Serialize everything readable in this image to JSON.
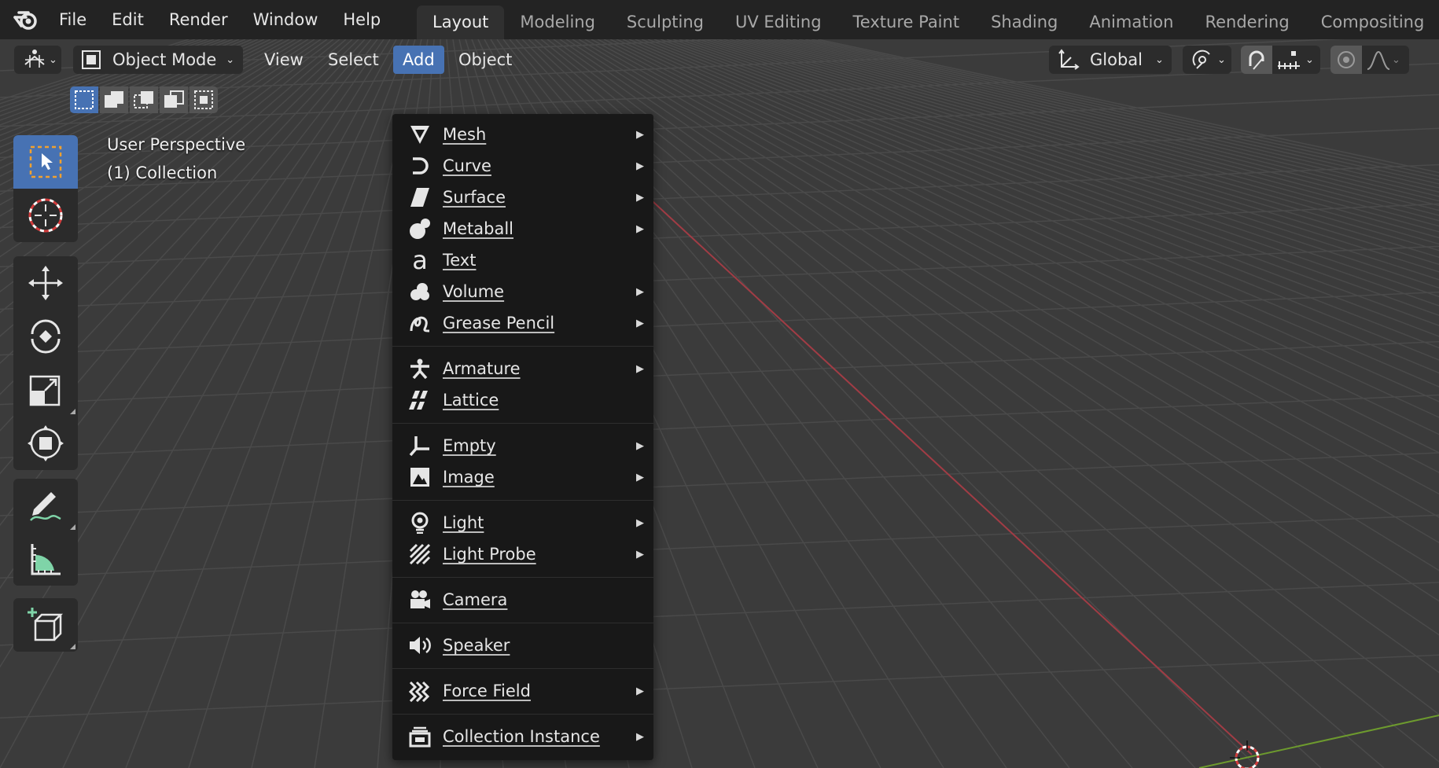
{
  "topbar": {
    "menus": [
      "File",
      "Edit",
      "Render",
      "Window",
      "Help"
    ],
    "workspaces": [
      "Layout",
      "Modeling",
      "Sculpting",
      "UV Editing",
      "Texture Paint",
      "Shading",
      "Animation",
      "Rendering",
      "Compositing"
    ],
    "active_workspace": "Layout"
  },
  "header": {
    "mode": "Object Mode",
    "menus": [
      "View",
      "Select",
      "Add",
      "Object"
    ],
    "active_menu": "Add",
    "transform_orientation": "Global"
  },
  "overlay": {
    "view_name": "User Perspective",
    "collection": "(1) Collection"
  },
  "add_menu": {
    "items": [
      {
        "label": "Mesh",
        "icon": "mesh-icon",
        "submenu": true
      },
      {
        "label": "Curve",
        "icon": "curve-icon",
        "submenu": true
      },
      {
        "label": "Surface",
        "icon": "surface-icon",
        "submenu": true
      },
      {
        "label": "Metaball",
        "icon": "metaball-icon",
        "submenu": true
      },
      {
        "label": "Text",
        "icon": "text-icon",
        "submenu": false
      },
      {
        "label": "Volume",
        "icon": "volume-icon",
        "submenu": true
      },
      {
        "label": "Grease Pencil",
        "icon": "grease-pencil-icon",
        "submenu": true
      },
      {
        "label": "Armature",
        "icon": "armature-icon",
        "submenu": true
      },
      {
        "label": "Lattice",
        "icon": "lattice-icon",
        "submenu": false
      },
      {
        "label": "Empty",
        "icon": "empty-icon",
        "submenu": true
      },
      {
        "label": "Image",
        "icon": "image-icon",
        "submenu": true
      },
      {
        "label": "Light",
        "icon": "light-icon",
        "submenu": true
      },
      {
        "label": "Light Probe",
        "icon": "light-probe-icon",
        "submenu": true
      },
      {
        "label": "Camera",
        "icon": "camera-icon",
        "submenu": false
      },
      {
        "label": "Speaker",
        "icon": "speaker-icon",
        "submenu": false
      },
      {
        "label": "Force Field",
        "icon": "force-field-icon",
        "submenu": true
      },
      {
        "label": "Collection Instance",
        "icon": "collection-instance-icon",
        "submenu": true
      }
    ]
  },
  "colors": {
    "accent": "#4772b3",
    "x_axis": "#a13c45",
    "y_axis": "#6d9a2e",
    "grid_bg": "#3b3b3b"
  }
}
